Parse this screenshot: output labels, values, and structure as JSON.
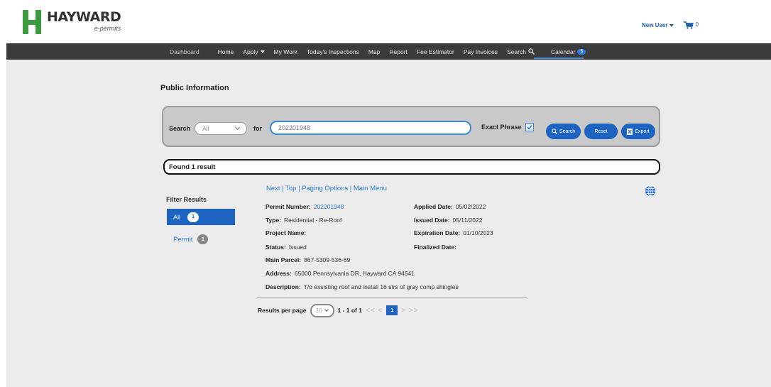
{
  "brand": {
    "name": "HAYWARD",
    "subtitle": "e-permits",
    "logo_color": "#3a9a3d"
  },
  "header": {
    "user_label": "New User",
    "cart_count": "0"
  },
  "nav": {
    "items": [
      "Dashboard",
      "Home",
      "Apply",
      "My Work",
      "Today's Inspections",
      "Map",
      "Report",
      "Fee Estimator",
      "Pay Invoices",
      "Search",
      "Calendar"
    ],
    "calendar_badge": "5"
  },
  "page": {
    "title": "Public Information"
  },
  "search": {
    "label": "Search",
    "scope_value": "All",
    "for_label": "for",
    "query": "202201948",
    "exact_phrase_label": "Exact Phrase",
    "exact_phrase_checked": true,
    "search_button": "Search",
    "reset_button": "Reset",
    "export_button": "Export"
  },
  "results": {
    "found_text": "Found 1 result",
    "paging_links": "Next | Top | Paging Options | Main Menu"
  },
  "filter": {
    "title": "Filter Results",
    "items": [
      {
        "label": "All",
        "count": "1"
      },
      {
        "label": "Permit",
        "count": "1"
      }
    ]
  },
  "permit": {
    "permit_number_label": "Permit Number:",
    "permit_number": "202201948",
    "type_label": "Type:",
    "type": "Residential - Re-Roof",
    "project_name_label": "Project Name:",
    "status_label": "Status:",
    "status": "Issued",
    "main_parcel_label": "Main Parcel:",
    "main_parcel": "867-5309-536-69",
    "address_label": "Address:",
    "address": "65000 Pennsylvania DR, Hayward CA 94541",
    "description_label": "Description:",
    "description": "T/o exsisting roof and install 16 strs of gray comp shingles",
    "applied_label": "Applied Date:",
    "applied": "05/02/2022",
    "issued_label": "Issued Date:",
    "issued": "05/11/2022",
    "expiration_label": "Expiration Date:",
    "expiration": "01/10/2023",
    "finalized_label": "Finalized Date:"
  },
  "pager": {
    "per_page_label": "Results per page",
    "per_page_value": "10",
    "range": "1 - 1 of 1",
    "first_prev": "<< <",
    "current_page": "1",
    "next_last": "> >>"
  }
}
